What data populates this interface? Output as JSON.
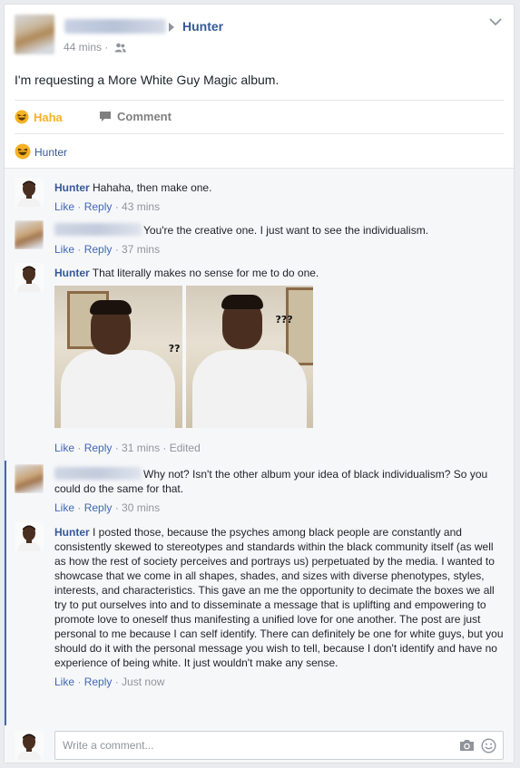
{
  "post": {
    "author_name": "Hunter",
    "time": "44 mins",
    "separator": "·",
    "audience_icon": "friends-icon",
    "text": "I'm requesting a More White Guy Magic album.",
    "actions": {
      "reaction_label": "Haha",
      "comment_label": "Comment"
    },
    "reactions_summary": {
      "icon": "haha-emoji",
      "names": "Hunter"
    }
  },
  "comments": [
    {
      "author": "Hunter",
      "text": "Hahaha, then make one.",
      "like": "Like",
      "reply": "Reply",
      "time": "43 mins"
    },
    {
      "author": "",
      "text": "You're the creative one. I just want to see the individualism.",
      "like": "Like",
      "reply": "Reply",
      "time": "37 mins"
    },
    {
      "author": "Hunter",
      "text": "That literally makes no sense for me to do one.",
      "image_text_left": "??",
      "image_text_right": "???",
      "like": "Like",
      "reply": "Reply",
      "time": "31 mins",
      "edited": "Edited"
    },
    {
      "author": "",
      "text": "Why not? Isn't the other album your idea of black individualism? So you could do the same for that.",
      "like": "Like",
      "reply": "Reply",
      "time": "30 mins"
    },
    {
      "author": "Hunter",
      "text": "I posted those, because the psyches among black people are constantly and consistently skewed to stereotypes and standards within the black community itself (as well as how the rest of society perceives and portrays us) perpetuated by the media. I wanted to showcase that we come in all shapes, shades, and sizes with diverse phenotypes, styles, interests, and characteristics. This gave an me the opportunity to decimate the boxes we all try to put ourselves into and to disseminate a message that is uplifting and empowering to promote love to oneself thus manifesting a unified love for one another. The post are just personal to me because I can self identify. There can definitely be one for white guys, but you should do it with the personal message you wish to tell, because I don't identify and have no experience of being white. It just wouldn't make any sense.",
      "like": "Like",
      "reply": "Reply",
      "time": "Just now"
    }
  ],
  "composer": {
    "placeholder": "Write a comment..."
  },
  "colors": {
    "link": "#365899",
    "meta": "#90949c",
    "haha": "#f7b125",
    "thread_line": "#4267b2"
  }
}
